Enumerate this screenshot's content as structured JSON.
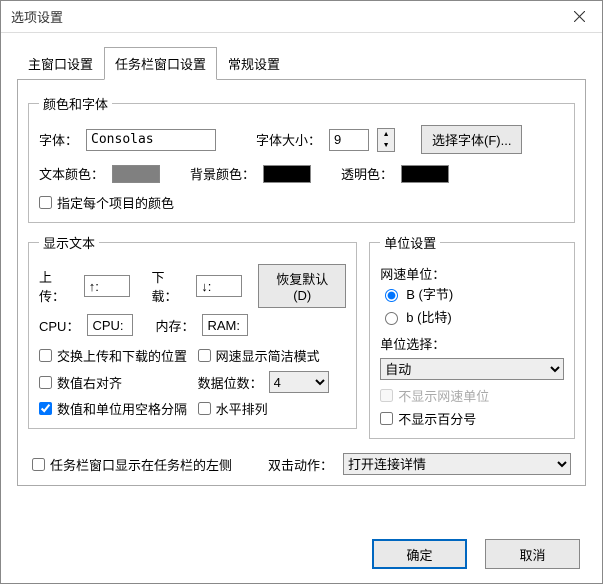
{
  "title": "选项设置",
  "tabs": [
    "主窗口设置",
    "任务栏窗口设置",
    "常规设置"
  ],
  "activeTab": 1,
  "fontGroup": {
    "legend": "颜色和字体",
    "fontLabel": "字体：",
    "fontValue": "Consolas",
    "fontSizeLabel": "字体大小：",
    "fontSizeValue": "9",
    "chooseFontBtn": "选择字体(F)...",
    "textColorLabel": "文本颜色：",
    "textColor": "#808080",
    "bgColorLabel": "背景颜色：",
    "bgColor": "#000000",
    "transColorLabel": "透明色：",
    "transColor": "#000000",
    "perItemColor": "指定每个项目的颜色"
  },
  "displayGroup": {
    "legend": "显示文本",
    "uploadLabel": "上传：",
    "uploadValue": "↑:",
    "downloadLabel": "下载：",
    "downloadValue": "↓:",
    "cpuLabel": "CPU：",
    "cpuValue": "CPU:",
    "memLabel": "内存：",
    "memValue": "RAM:",
    "restoreBtn": "恢复默认(D)",
    "swapPos": "交换上传和下载的位置",
    "netConciseMode": "网速显示简洁模式",
    "rightAlign": "数值右对齐",
    "digitsLabel": "数据位数：",
    "digitsValue": "4",
    "spaceSep": "数值和单位用空格分隔",
    "horizontal": "水平排列"
  },
  "unitGroup": {
    "legend": "单位设置",
    "netUnitLabel": "网速单位：",
    "radioByte": "B (字节)",
    "radioBit": "b (比特)",
    "selectedRadio": "byte",
    "unitSelectLabel": "单位选择：",
    "unitSelectValue": "自动",
    "hideNetUnit": "不显示网速单位",
    "hidePercent": "不显示百分号"
  },
  "footer": {
    "showLeftSide": "任务栏窗口显示在任务栏的左侧",
    "dblClickLabel": "双击动作：",
    "dblClickValue": "打开连接详情"
  },
  "buttons": {
    "ok": "确定",
    "cancel": "取消"
  }
}
